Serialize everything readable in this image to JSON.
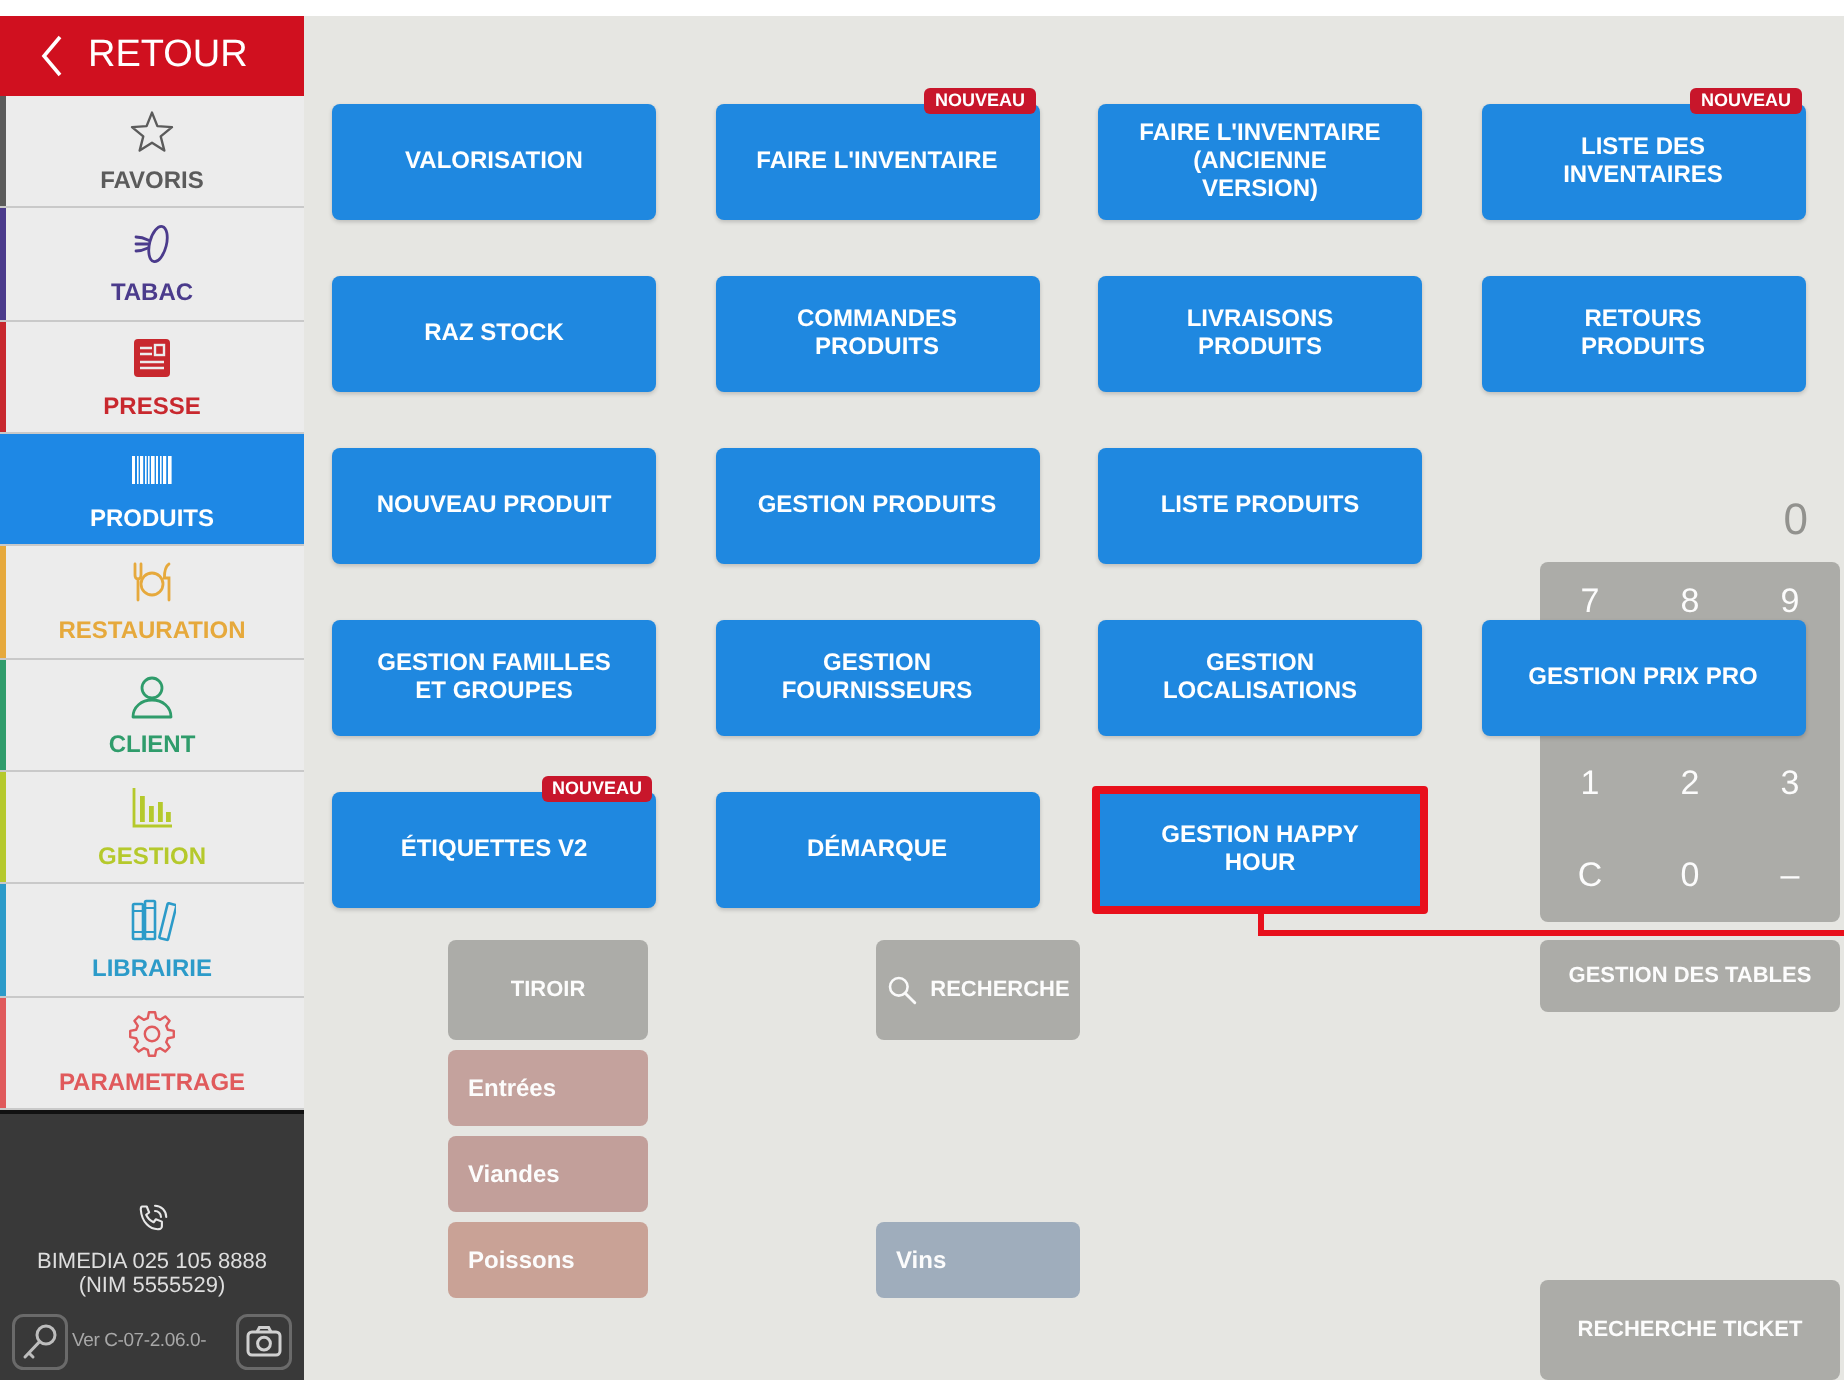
{
  "sidebar": {
    "back_label": "RETOUR",
    "items": [
      {
        "label": "FAVORIS",
        "color": "#5b5b5b",
        "selected": false
      },
      {
        "label": "TABAC",
        "color": "#4b3b8c",
        "selected": false
      },
      {
        "label": "PRESSE",
        "color": "#c8282e",
        "selected": false
      },
      {
        "label": "PRODUITS",
        "color": "#1e88e5",
        "selected": true
      },
      {
        "label": "RESTAURATION",
        "color": "#e6a93c",
        "selected": false
      },
      {
        "label": "CLIENT",
        "color": "#2f9c6b",
        "selected": false
      },
      {
        "label": "GESTION",
        "color": "#b5c92c",
        "selected": false
      },
      {
        "label": "LIBRAIRIE",
        "color": "#2c9bc9",
        "selected": false
      },
      {
        "label": "PARAMETRAGE",
        "color": "#e05a5c",
        "selected": false
      }
    ],
    "footer": {
      "contact": "BIMEDIA 025 105 8888",
      "nim": "(NIM 5555529)",
      "version": "Ver C-07-2.06.0-"
    }
  },
  "menu": {
    "rows": [
      [
        {
          "label": "VALORISATION",
          "highlighted": false
        },
        {
          "label": "FAIRE L'INVENTAIRE",
          "badge": "NOUVEAU",
          "highlighted": false
        },
        {
          "label": "FAIRE L'INVENTAIRE\n(ANCIENNE\nVERSION)",
          "highlighted": false
        },
        {
          "label": "LISTE DES\nINVENTAIRES",
          "badge": "NOUVEAU",
          "highlighted": false
        }
      ],
      [
        {
          "label": "RAZ STOCK",
          "highlighted": false
        },
        {
          "label": "COMMANDES\nPRODUITS",
          "highlighted": false
        },
        {
          "label": "LIVRAISONS\nPRODUITS",
          "highlighted": false
        },
        {
          "label": "RETOURS\nPRODUITS",
          "highlighted": false
        }
      ],
      [
        {
          "label": "NOUVEAU PRODUIT",
          "highlighted": false
        },
        {
          "label": "GESTION PRODUITS",
          "highlighted": false
        },
        {
          "label": "LISTE PRODUITS",
          "highlighted": false
        }
      ],
      [
        {
          "label": "GESTION FAMILLES\nET GROUPES",
          "highlighted": false
        },
        {
          "label": "GESTION\nFOURNISSEURS",
          "highlighted": false
        },
        {
          "label": "GESTION\nLOCALISATIONS",
          "highlighted": false
        },
        {
          "label": "GESTION PRIX PRO",
          "highlighted": false
        }
      ],
      [
        {
          "label": "ÉTIQUETTES V2",
          "badge": "NOUVEAU",
          "highlighted": false
        },
        {
          "label": "DÉMARQUE",
          "highlighted": false
        },
        {
          "label": "GESTION HAPPY\nHOUR",
          "highlighted": true
        }
      ]
    ]
  },
  "background_screen": {
    "toolbar": [
      {
        "label": "TIROIR"
      },
      {
        "label": "RECHERCHE"
      }
    ],
    "tables_button": "GESTION DES TABLES",
    "categories": [
      {
        "label": "Entrées",
        "color": "#c4a29d"
      },
      {
        "label": "Viandes",
        "color": "#c29f9a"
      },
      {
        "label": "Poissons",
        "color": "#c9a296"
      }
    ],
    "drinks": [
      {
        "label": "Vins",
        "color": "#9fadbc"
      }
    ],
    "display": "0",
    "keypad": [
      [
        "7",
        "8",
        "9"
      ],
      [
        "1",
        "2",
        "3"
      ],
      [
        "C",
        "0",
        "–"
      ]
    ],
    "ticket_search": "RECHERCHE TICKET"
  }
}
